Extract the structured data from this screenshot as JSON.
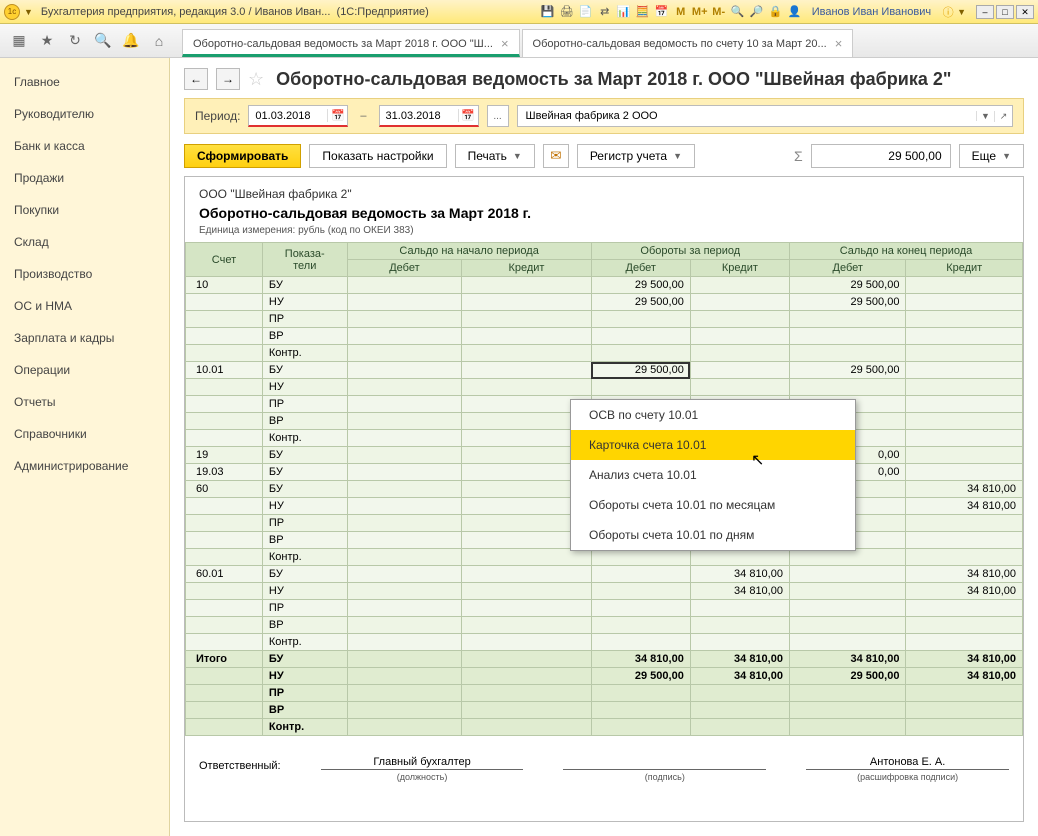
{
  "titlebar": {
    "app_title": "Бухгалтерия предприятия, редакция 3.0 / Иванов Иван...",
    "app_mode": "(1С:Предприятие)",
    "user": "Иванов Иван Иванович"
  },
  "tabs": {
    "active": "Оборотно-сальдовая ведомость за Март 2018 г. ООО \"Ш...",
    "second": "Оборотно-сальдовая ведомость по счету 10 за Март 20..."
  },
  "sidebar": {
    "items": [
      "Главное",
      "Руководителю",
      "Банк и касса",
      "Продажи",
      "Покупки",
      "Склад",
      "Производство",
      "ОС и НМА",
      "Зарплата и кадры",
      "Операции",
      "Отчеты",
      "Справочники",
      "Администрирование"
    ]
  },
  "page": {
    "title": "Оборотно-сальдовая ведомость за Март 2018 г. ООО \"Швейная фабрика 2\""
  },
  "period": {
    "label": "Период:",
    "from": "01.03.2018",
    "to": "31.03.2018",
    "dash": "–",
    "dots": "...",
    "org": "Швейная фабрика 2 ООО"
  },
  "actions": {
    "form": "Сформировать",
    "settings": "Показать настройки",
    "print": "Печать",
    "register": "Регистр учета",
    "more": "Еще",
    "total": "29 500,00"
  },
  "report": {
    "org": "ООО \"Швейная фабрика 2\"",
    "title": "Оборотно-сальдовая ведомость за Март 2018 г.",
    "unit": "Единица измерения:  рубль (код по ОКЕИ 383)",
    "headers": {
      "account": "Счет",
      "indicators": "Показа-\nтели",
      "saldo_start": "Сальдо на начало периода",
      "turnover": "Обороты за период",
      "saldo_end": "Сальдо на конец периода",
      "debit": "Дебет",
      "credit": "Кредит"
    },
    "rows": [
      {
        "acct": "10",
        "ind": "БУ",
        "od": "29 500,00",
        "sed": "29 500,00"
      },
      {
        "acct": "",
        "ind": "НУ",
        "od": "29 500,00",
        "sed": "29 500,00"
      },
      {
        "acct": "",
        "ind": "ПР"
      },
      {
        "acct": "",
        "ind": "ВР"
      },
      {
        "acct": "",
        "ind": "Контр."
      },
      {
        "acct": "10.01",
        "ind": "БУ",
        "od": "29 500,00",
        "sed": "29 500,00",
        "sel": true
      },
      {
        "acct": "",
        "ind": "НУ"
      },
      {
        "acct": "",
        "ind": "ПР"
      },
      {
        "acct": "",
        "ind": "ВР"
      },
      {
        "acct": "",
        "ind": "Контр."
      },
      {
        "acct": "19",
        "ind": "БУ",
        "sed": "0,00"
      },
      {
        "acct": "19.03",
        "ind": "БУ",
        "sed": "0,00"
      },
      {
        "acct": "60",
        "ind": "БУ",
        "oc": "",
        "sec": "34 810,00"
      },
      {
        "acct": "",
        "ind": "НУ",
        "sec": "34 810,00"
      },
      {
        "acct": "",
        "ind": "ПР"
      },
      {
        "acct": "",
        "ind": "ВР"
      },
      {
        "acct": "",
        "ind": "Контр."
      },
      {
        "acct": "60.01",
        "ind": "БУ",
        "oc": "34 810,00",
        "sec": "34 810,00"
      },
      {
        "acct": "",
        "ind": "НУ",
        "oc": "34 810,00",
        "sec": "34 810,00"
      },
      {
        "acct": "",
        "ind": "ПР"
      },
      {
        "acct": "",
        "ind": "ВР"
      },
      {
        "acct": "",
        "ind": "Контр."
      }
    ],
    "totals": [
      {
        "ind": "БУ",
        "od": "34 810,00",
        "oc": "34 810,00",
        "sed": "34 810,00",
        "sec": "34 810,00"
      },
      {
        "ind": "НУ",
        "od": "29 500,00",
        "oc": "34 810,00",
        "sed": "29 500,00",
        "sec": "34 810,00"
      },
      {
        "ind": "ПР"
      },
      {
        "ind": "ВР"
      },
      {
        "ind": "Контр."
      }
    ],
    "totals_label": "Итого",
    "footer": {
      "responsible": "Ответственный:",
      "position": "Главный бухгалтер",
      "position_label": "(должность)",
      "sign_label": "(подпись)",
      "name": "Антонова Е. А.",
      "name_label": "(расшифровка подписи)"
    }
  },
  "context_menu": {
    "items": [
      "ОСВ по счету 10.01",
      "Карточка счета 10.01",
      "Анализ счета 10.01",
      "Обороты счета 10.01 по месяцам",
      "Обороты счета 10.01 по дням"
    ],
    "highlighted": 1
  }
}
